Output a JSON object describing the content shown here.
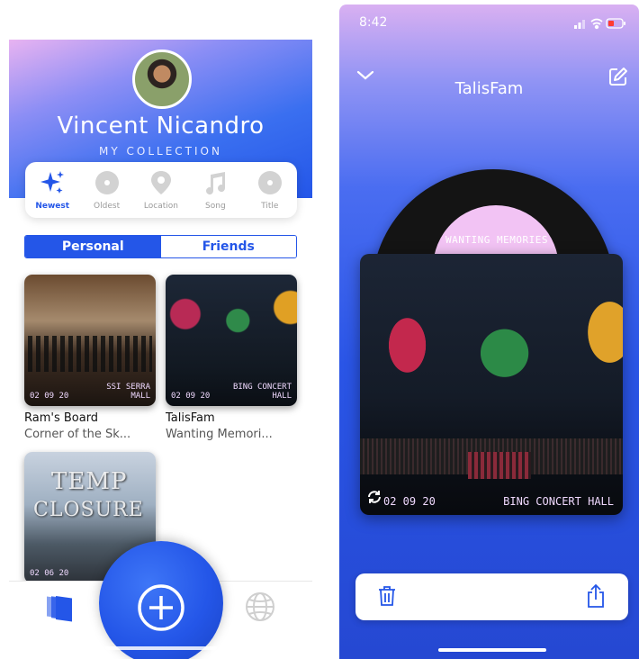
{
  "collection_screen": {
    "user_name": "Vincent Nicandro",
    "subtitle": "MY COLLECTION",
    "sort_options": [
      {
        "label": "Newest",
        "icon": "sparkles-icon",
        "active": true
      },
      {
        "label": "Oldest",
        "icon": "disc-icon",
        "active": false
      },
      {
        "label": "Location",
        "icon": "location-pin-icon",
        "active": false
      },
      {
        "label": "Song",
        "icon": "music-note-icon",
        "active": false
      },
      {
        "label": "Title",
        "icon": "disc-icon",
        "active": false
      }
    ],
    "segment": {
      "personal": "Personal",
      "friends": "Friends",
      "selected": "Personal"
    },
    "memories": [
      {
        "date": "02 09 20",
        "venue_line1": "SSI SERRA",
        "venue_line2": "MALL",
        "title": "Ram's Board",
        "subtitle": "Corner of the Sk..."
      },
      {
        "date": "02 09 20",
        "venue_line1": "BING CONCERT",
        "venue_line2": "HALL",
        "title": "TalisFam",
        "subtitle": "Wanting Memori..."
      },
      {
        "date": "02 06 20",
        "sign_line1": "TEMP",
        "sign_line2": "CLOSURE"
      }
    ],
    "tabbar": {
      "left_icon": "collection-icon",
      "center_icon": "add-icon",
      "right_icon": "globe-icon"
    }
  },
  "memory_detail_screen": {
    "status_time": "8:42",
    "title": "TalisFam",
    "record_label": "WANTING MEMORIES",
    "photo_date": "02 09 20",
    "photo_venue": "BING CONCERT HALL",
    "actions": {
      "left": "trash-icon",
      "right": "share-icon"
    }
  },
  "colors": {
    "accent": "#2456e8",
    "gradient_top": "#e8b3f1",
    "label_pink": "#f2c3f4",
    "lcd_text": "#f0d9ff"
  }
}
